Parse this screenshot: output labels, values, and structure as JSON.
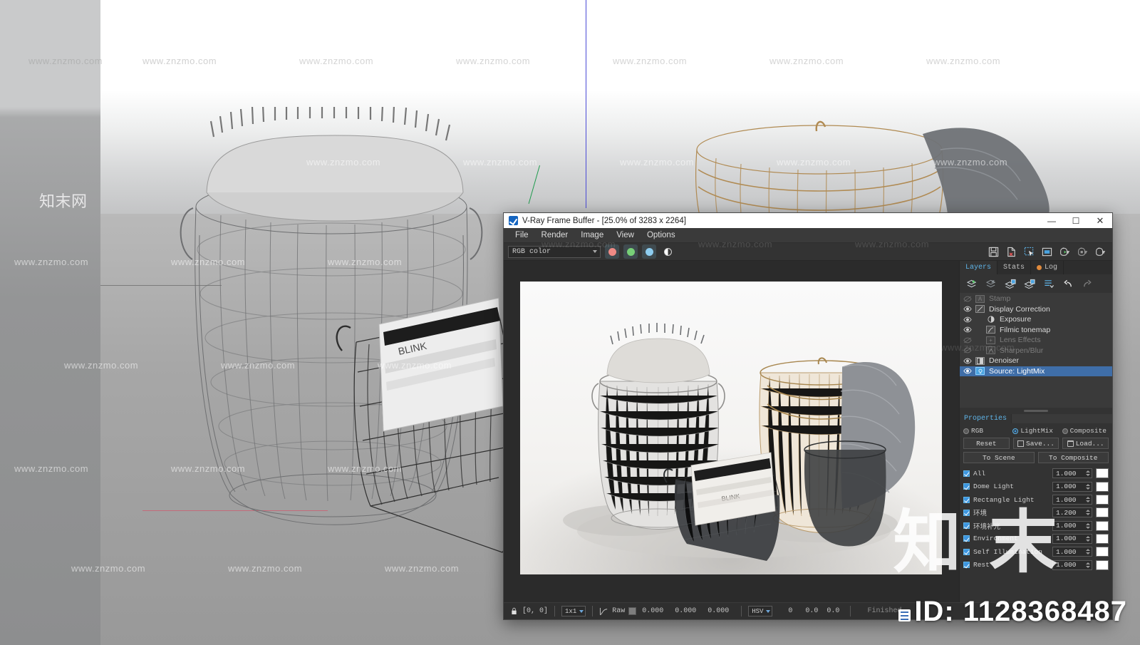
{
  "window": {
    "title": "V-Ray Frame Buffer - [25.0% of 3283 x 2264]",
    "app_icon": "vray-icon",
    "controls": {
      "minimize": "—",
      "maximize": "☐",
      "close": "✕"
    }
  },
  "menu": {
    "items": [
      "File",
      "Render",
      "Image",
      "View",
      "Options"
    ]
  },
  "toolbar": {
    "channel_select": "RGB color",
    "channels": [
      {
        "name": "red-channel-toggle",
        "color": "#ef8a85"
      },
      {
        "name": "green-channel-toggle",
        "color": "#77cf77"
      },
      {
        "name": "blue-channel-toggle",
        "color": "#8ecdf0"
      },
      {
        "name": "alpha-channel-toggle",
        "color": "#ffffff"
      }
    ],
    "buttons": [
      "save-image-button",
      "save-failed-image-button",
      "region-render-button",
      "show-vfb-frame-button",
      "render-last-button",
      "stop-render-button",
      "render-button"
    ]
  },
  "layers_panel": {
    "tabs": [
      {
        "label": "Layers",
        "active": true
      },
      {
        "label": "Stats",
        "active": false
      },
      {
        "label": "Log",
        "active": false,
        "dot": "#e08a3c"
      }
    ],
    "toolbar_buttons": [
      "add-layer-button",
      "delete-layer-button",
      "duplicate-layer-button",
      "load-layer-button",
      "layer-list-button",
      "undo-button",
      "redo-button"
    ],
    "layers": [
      {
        "label": "Stamp",
        "enabled": false,
        "selected": false,
        "icon": "stamp-icon"
      },
      {
        "label": "Display Correction",
        "enabled": true,
        "selected": false,
        "icon": "display-correction-icon"
      },
      {
        "label": "Exposure",
        "enabled": true,
        "selected": false,
        "icon": "exposure-icon",
        "indent": true
      },
      {
        "label": "Filmic tonemap",
        "enabled": true,
        "selected": false,
        "icon": "filmic-tonemap-icon",
        "indent": true
      },
      {
        "label": "Lens Effects",
        "enabled": false,
        "selected": false,
        "icon": "lens-effects-icon",
        "indent": true
      },
      {
        "label": "Sharpen/Blur",
        "enabled": false,
        "selected": false,
        "icon": "sharpen-blur-icon",
        "indent": true
      },
      {
        "label": "Denoiser",
        "enabled": true,
        "selected": false,
        "icon": "denoiser-icon"
      },
      {
        "label": "Source: LightMix",
        "enabled": true,
        "selected": true,
        "icon": "lightmix-source-icon"
      }
    ]
  },
  "properties": {
    "tab_label": "Properties",
    "modes": [
      {
        "label": "RGB",
        "selected": false
      },
      {
        "label": "LightMix",
        "selected": true
      },
      {
        "label": "Composite",
        "selected": false
      }
    ],
    "buttons": {
      "reset": "Reset",
      "save": "Save...",
      "load": "Load...",
      "to_scene": "To Scene",
      "to_composite": "To Composite"
    },
    "lights": [
      {
        "name": "All",
        "enabled": true,
        "value": "1.000",
        "color": "#ffffff"
      },
      {
        "name": "Dome Light",
        "enabled": true,
        "value": "1.000",
        "color": "#ffffff"
      },
      {
        "name": "Rectangle Light",
        "enabled": true,
        "value": "1.000",
        "color": "#ffffff"
      },
      {
        "name": "环境",
        "enabled": true,
        "value": "1.200",
        "color": "#ffffff"
      },
      {
        "name": "环境补光",
        "enabled": true,
        "value": "1.000",
        "color": "#ffffff"
      },
      {
        "name": "Environment",
        "enabled": true,
        "value": "1.000",
        "color": "#ffffff"
      },
      {
        "name": "Self Illumination",
        "enabled": true,
        "value": "1.000",
        "color": "#ffffff"
      },
      {
        "name": "Rest",
        "enabled": true,
        "value": "1.000",
        "color": "#ffffff"
      }
    ]
  },
  "statusbar": {
    "lock_icon": "lock-icon",
    "pixel_coords": "[0, 0]",
    "zoom_region": "1x1",
    "curve_icon": "curve-icon",
    "raw_label": "Raw",
    "color_swatch": "#7e7e7e",
    "values": [
      "0.000",
      "0.000",
      "0.000"
    ],
    "color_mode": "HSV",
    "hsv_values": [
      "0",
      "0.0",
      "0.0"
    ],
    "status": "Finished"
  },
  "watermarks": {
    "site_text": "www.znzmo.com",
    "brand_cn": "知末网",
    "big_cn": "知 末",
    "id_text": "ID: 1128368487"
  },
  "scene": {
    "background_label": "sketchup-viewport"
  }
}
